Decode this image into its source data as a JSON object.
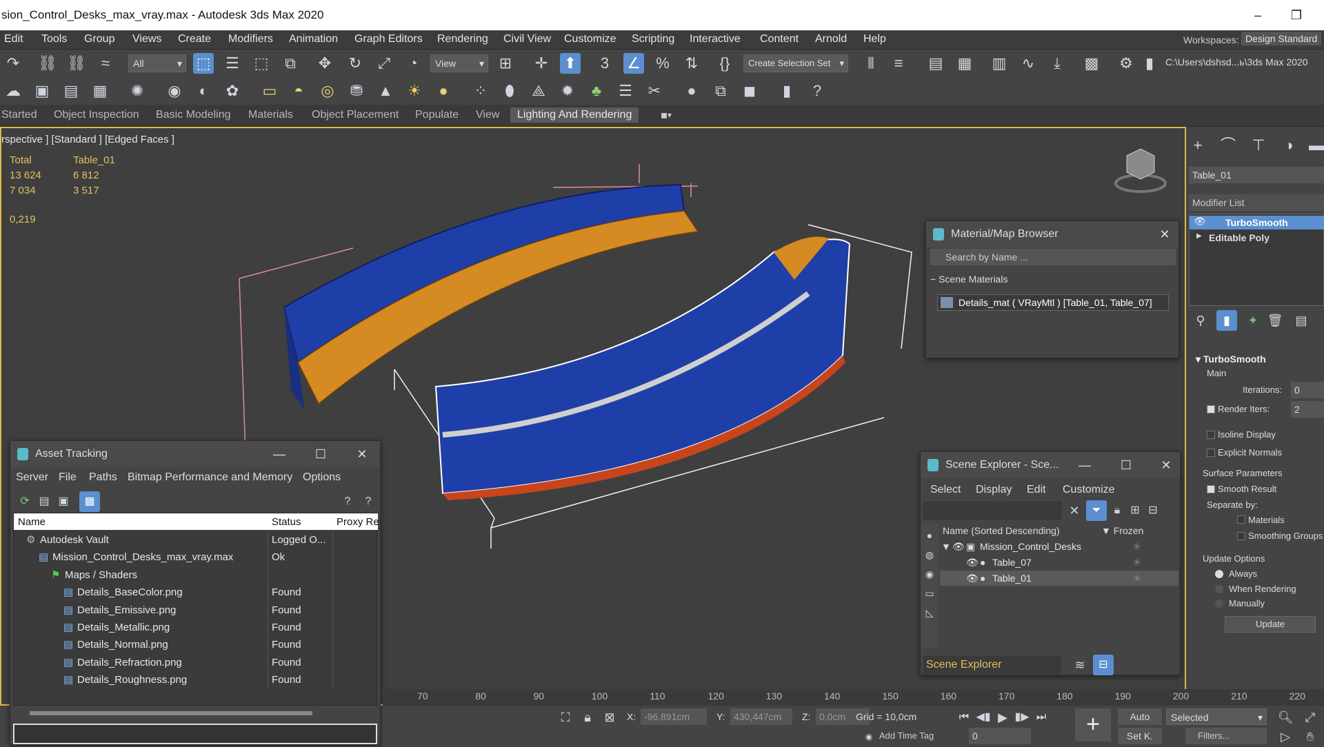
{
  "window": {
    "title": "sion_Control_Desks_max_vray.max - Autodesk 3ds Max 2020",
    "min": "–",
    "max": "❐",
    "close": "✕"
  },
  "menu": [
    "Edit",
    "Tools",
    "Group",
    "Views",
    "Create",
    "Modifiers",
    "Animation",
    "Graph Editors",
    "Rendering",
    "Civil View",
    "Customize",
    "Scripting",
    "Interactive",
    "Content",
    "Arnold",
    "Help"
  ],
  "workspaces": {
    "label": "Workspaces:",
    "value": "Design Standard"
  },
  "toolbar": {
    "filter": "All",
    "refcoord": "View",
    "selection_set": "Create Selection Set",
    "path": "C:\\Users\\dshsd...ь\\3ds Max 2020"
  },
  "ribbon_tabs": [
    "Started",
    "Object Inspection",
    "Basic Modeling",
    "Materials",
    "Object Placement",
    "Populate",
    "View",
    "Lighting And Rendering"
  ],
  "viewport": {
    "label": "rspective ] [Standard ] [Edged Faces ]",
    "stats": {
      "h1": "Total",
      "h2": "Table_01",
      "r1a": "13 624",
      "r1b": "6 812",
      "r2a": "7 034",
      "r2b": "3 517",
      "fps": "0,219"
    }
  },
  "material_browser": {
    "title": "Material/Map Browser",
    "search": "Search by Name ...",
    "section": "Scene Materials",
    "item": "Details_mat  ( VRayMtl )  [Table_01, Table_07]"
  },
  "asset_tracking": {
    "title": "Asset Tracking",
    "menu": [
      "Server",
      "File",
      "Paths",
      "Bitmap Performance and Memory",
      "Options"
    ],
    "cols": [
      "Name",
      "Status",
      "Proxy Re"
    ],
    "rows": [
      {
        "name": "Autodesk Vault",
        "status": "Logged O...",
        "indent": 1,
        "icon": "vault-icon"
      },
      {
        "name": "Mission_Control_Desks_max_vray.max",
        "status": "Ok",
        "indent": 2,
        "icon": "max-file-icon"
      },
      {
        "name": "Maps / Shaders",
        "status": "",
        "indent": 3,
        "icon": "maps-icon"
      },
      {
        "name": "Details_BaseColor.png",
        "status": "Found",
        "indent": 4,
        "icon": "image-file-icon"
      },
      {
        "name": "Details_Emissive.png",
        "status": "Found",
        "indent": 4,
        "icon": "image-file-icon"
      },
      {
        "name": "Details_Metallic.png",
        "status": "Found",
        "indent": 4,
        "icon": "image-file-icon"
      },
      {
        "name": "Details_Normal.png",
        "status": "Found",
        "indent": 4,
        "icon": "image-file-icon"
      },
      {
        "name": "Details_Refraction.png",
        "status": "Found",
        "indent": 4,
        "icon": "image-file-icon"
      },
      {
        "name": "Details_Roughness.png",
        "status": "Found",
        "indent": 4,
        "icon": "image-file-icon"
      }
    ]
  },
  "scene_explorer": {
    "title": "Scene Explorer - Sce...",
    "menu": [
      "Select",
      "Display",
      "Edit",
      "Customize"
    ],
    "col_name": "Name (Sorted Descending)",
    "col_frozen": "▼ Frozen",
    "rows": [
      {
        "name": "Mission_Control_Desks",
        "level": 0
      },
      {
        "name": "Table_07",
        "level": 1
      },
      {
        "name": "Table_01",
        "level": 1
      }
    ],
    "footer": "Scene Explorer"
  },
  "command_panel": {
    "object_name": "Table_01",
    "modifier_list": "Modifier List",
    "stack": [
      "TurboSmooth",
      "Editable Poly"
    ],
    "rollout": "TurboSmooth",
    "main": "Main",
    "iterations_label": "Iterations:",
    "iterations": "0",
    "render_iters_label": "Render Iters:",
    "render_iters": "2",
    "isoline": "Isoline Display",
    "explicit": "Explicit Normals",
    "surface": "Surface Parameters",
    "smooth": "Smooth Result",
    "separate": "Separate by:",
    "materials": "Materials",
    "smoothing": "Smoothing Groups",
    "update_opts": "Update Options",
    "always": "Always",
    "when_rendering": "When Rendering",
    "manually": "Manually",
    "update": "Update"
  },
  "timeline": [
    "70",
    "80",
    "90",
    "100",
    "110",
    "120",
    "130",
    "140",
    "150",
    "160",
    "170",
    "180",
    "190",
    "200",
    "210",
    "220"
  ],
  "status": {
    "x_label": "X:",
    "x": "-96,891cm",
    "y_label": "Y:",
    "y": "430,447cm",
    "z_label": "Z:",
    "z": "0,0cm",
    "grid": "Grid = 10,0cm",
    "auto": "Auto",
    "selected": "Selected",
    "setk": "Set K.",
    "filters": "Filters...",
    "frame": "0",
    "addtag": "Add Time Tag"
  }
}
